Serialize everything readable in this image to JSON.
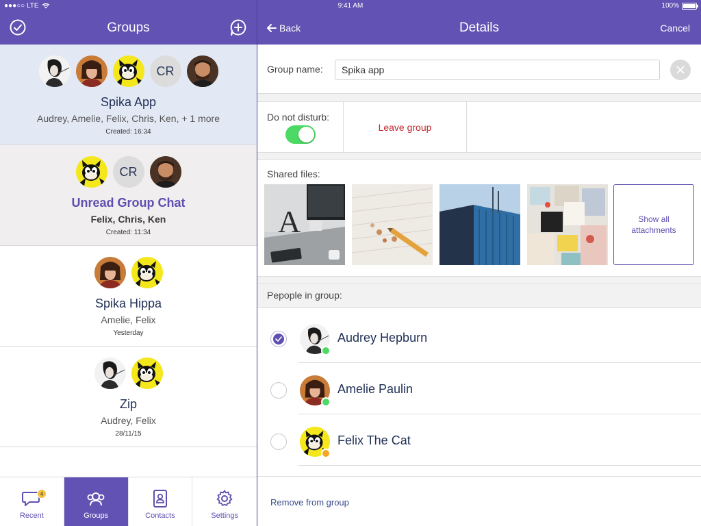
{
  "status_bar": {
    "carrier": "●●●○○ LTE",
    "time": "9:41 AM",
    "battery": "100%"
  },
  "left_nav": {
    "title": "Groups"
  },
  "right_nav": {
    "back_label": "Back",
    "title": "Details",
    "cancel_label": "Cancel"
  },
  "groups": [
    {
      "name": "Spika App",
      "members": "Audrey, Amelie, Felix, Chris, Ken,  + 1 more",
      "created": "Created: 16:34"
    },
    {
      "name": "Unread Group Chat",
      "members": "Felix, Chris, Ken",
      "created": "Created: 11:34"
    },
    {
      "name": "Spika Hippa",
      "members": "Amelie, Felix",
      "created": "Yesterday"
    },
    {
      "name": "Zip",
      "members": "Audrey, Felix",
      "created": "28/11/15"
    }
  ],
  "avatar_initials": {
    "chris": "CR"
  },
  "tabs": [
    {
      "label": "Recent",
      "badge": "4"
    },
    {
      "label": "Groups"
    },
    {
      "label": "Contacts"
    },
    {
      "label": "Settings"
    }
  ],
  "details": {
    "group_name_label": "Group name:",
    "group_name_value": "Spika app",
    "dnd_label": "Do not disturb:",
    "dnd_on": true,
    "leave_label": "Leave group",
    "shared_files_label": "Shared files:",
    "show_all_line1": "Show all",
    "show_all_line2": "attachments",
    "people_label": "Pepople in group:",
    "people": [
      {
        "name": "Audrey Hepburn",
        "checked": true,
        "presence": "online"
      },
      {
        "name": "Amelie Paulin",
        "checked": false,
        "presence": "online"
      },
      {
        "name": "Felix The Cat",
        "checked": false,
        "presence": "away"
      }
    ],
    "remove_label": "Remove from group"
  },
  "colors": {
    "brand": "#6152b3",
    "online": "#4cd964",
    "away": "#f5a623",
    "danger": "#c0272d",
    "selected_row": "#e3e9f4"
  }
}
